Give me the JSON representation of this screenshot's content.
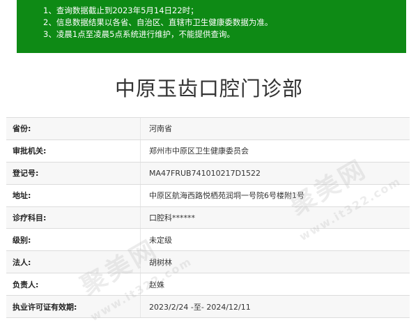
{
  "notice": {
    "lines": [
      "1、查询数据截止到2023年5月14日22时；",
      "2、信息数据结果以各省、自治区、直辖市卫生健康委数据为准。",
      "3、凌晨1点至凌晨5点系统进行维护，不能提供查询。"
    ]
  },
  "title": "中原玉齿口腔门诊部",
  "rows": [
    {
      "label": "省份:",
      "value": "河南省"
    },
    {
      "label": "审批机关:",
      "value": "郑州市中原区卫生健康委员会"
    },
    {
      "label": "登记号:",
      "value": "MA47FRUB741010217D1522"
    },
    {
      "label": "地址:",
      "value": "中原区航海西路悦栖苑润垌一号院6号楼附1号"
    },
    {
      "label": "诊疗科目:",
      "value": "口腔科******"
    },
    {
      "label": "级别:",
      "value": "未定级"
    },
    {
      "label": "法人:",
      "value": "胡树林"
    },
    {
      "label": "负责人:",
      "value": "赵姝"
    },
    {
      "label": "执业许可证有效期:",
      "value": "2023/2/24 -至- 2024/12/11"
    }
  ],
  "watermark": {
    "text": "聚美网",
    "url": "www.it322.com"
  }
}
